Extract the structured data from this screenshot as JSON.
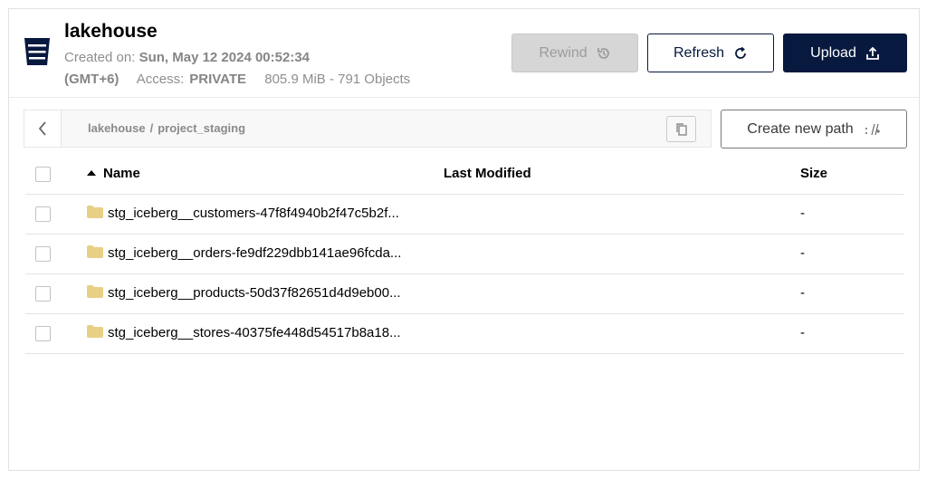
{
  "bucket": {
    "name": "lakehouse",
    "created_label": "Created on:",
    "created_value": "Sun, May 12 2024 00:52:34",
    "timezone": "(GMT+6)",
    "access_label": "Access:",
    "access_value": "PRIVATE",
    "usage": "805.9 MiB - 791 Objects"
  },
  "actions": {
    "rewind_label": "Rewind",
    "refresh_label": "Refresh",
    "upload_label": "Upload"
  },
  "breadcrumb": {
    "root": "lakehouse",
    "separator": "/",
    "current": "project_staging"
  },
  "create_path_label": "Create new path",
  "table": {
    "headers": {
      "name": "Name",
      "last_modified": "Last Modified",
      "size": "Size"
    },
    "rows": [
      {
        "name": "stg_iceberg__customers-47f8f4940b2f47c5b2f...",
        "last_modified": "",
        "size": "-"
      },
      {
        "name": "stg_iceberg__orders-fe9df229dbb141ae96fcda...",
        "last_modified": "",
        "size": "-"
      },
      {
        "name": "stg_iceberg__products-50d37f82651d4d9eb00...",
        "last_modified": "",
        "size": "-"
      },
      {
        "name": "stg_iceberg__stores-40375fe448d54517b8a18...",
        "last_modified": "",
        "size": "-"
      }
    ]
  },
  "colors": {
    "primary": "#07193e",
    "disabled_bg": "#d6d6d6",
    "folder": "#e8cf86"
  }
}
